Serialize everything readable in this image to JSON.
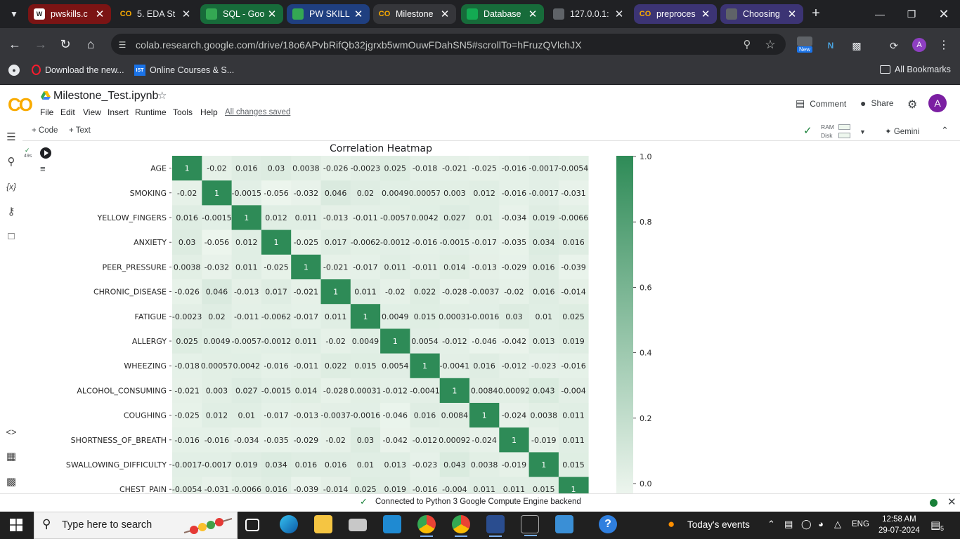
{
  "browser": {
    "tabs": [
      {
        "title": "pwskills.c",
        "style": "red",
        "icon": "github-icon"
      },
      {
        "title": "5. EDA St",
        "style": "dark",
        "icon": "colab-icon"
      },
      {
        "title": "SQL - Goo",
        "style": "green",
        "icon": "drive-icon"
      },
      {
        "title": "PW SKILL",
        "style": "blue",
        "icon": "drive-icon"
      },
      {
        "title": "Milestone",
        "style": "active",
        "icon": "colab-icon"
      },
      {
        "title": "Database",
        "style": "green",
        "icon": "mongodb-icon"
      },
      {
        "title": "127.0.0.1:",
        "style": "dark",
        "icon": "globe-icon"
      },
      {
        "title": "preproces",
        "style": "purple",
        "icon": "colab-icon"
      },
      {
        "title": "Choosing",
        "style": "purple",
        "icon": "globe-icon"
      }
    ],
    "url": "colab.research.google.com/drive/18o6APvbRifQb32jgrxb5wmOuwFDahSN5#scrollTo=hFruzQVlchJX",
    "new_badge": "New",
    "profile_initial": "A",
    "bookmarks": [
      {
        "label": "Download the new...",
        "icon": "opera-icon"
      },
      {
        "label": "Online Courses & S...",
        "icon": "ist-icon"
      }
    ],
    "all_bookmarks": "All Bookmarks"
  },
  "colab": {
    "logo": "CO",
    "notebook_title": "Milestone_Test.ipynb",
    "menu": [
      "File",
      "Edit",
      "View",
      "Insert",
      "Runtime",
      "Tools",
      "Help"
    ],
    "saved_status": "All changes saved",
    "comment_label": "Comment",
    "share_label": "Share",
    "avatar_initial": "A",
    "add_code": "+ Code",
    "add_text": "+ Text",
    "ram_label": "RAM",
    "disk_label": "Disk",
    "gemini_label": "Gemini",
    "cell_exec_time": "49s",
    "status_text": "Connected to Python 3 Google Compute Engine backend"
  },
  "chart_data": {
    "type": "heatmap",
    "title": "Correlation Heatmap",
    "rows": [
      "AGE",
      "SMOKING",
      "YELLOW_FINGERS",
      "ANXIETY",
      "PEER_PRESSURE",
      "CHRONIC_DISEASE",
      "FATIGUE",
      "ALLERGY",
      "WHEEZING",
      "ALCOHOL_CONSUMING",
      "COUGHING",
      "SHORTNESS_OF_BREATH",
      "SWALLOWING_DIFFICULTY",
      "CHEST_PAIN"
    ],
    "values": [
      [
        "1",
        "-0.02",
        "0.016",
        "0.03",
        "0.0038",
        "-0.026",
        "-0.0023",
        "0.025",
        "-0.018",
        "-0.021",
        "-0.025",
        "-0.016",
        "-0.0017",
        "-0.0054"
      ],
      [
        "-0.02",
        "1",
        "-0.0015",
        "-0.056",
        "-0.032",
        "0.046",
        "0.02",
        "0.0049",
        "0.00057",
        "0.003",
        "0.012",
        "-0.016",
        "-0.0017",
        "-0.031"
      ],
      [
        "0.016",
        "-0.0015",
        "1",
        "0.012",
        "0.011",
        "-0.013",
        "-0.011",
        "-0.0057",
        "0.0042",
        "0.027",
        "0.01",
        "-0.034",
        "0.019",
        "-0.0066"
      ],
      [
        "0.03",
        "-0.056",
        "0.012",
        "1",
        "-0.025",
        "0.017",
        "-0.0062",
        "-0.0012",
        "-0.016",
        "-0.0015",
        "-0.017",
        "-0.035",
        "0.034",
        "0.016"
      ],
      [
        "0.0038",
        "-0.032",
        "0.011",
        "-0.025",
        "1",
        "-0.021",
        "-0.017",
        "0.011",
        "-0.011",
        "0.014",
        "-0.013",
        "-0.029",
        "0.016",
        "-0.039"
      ],
      [
        "-0.026",
        "0.046",
        "-0.013",
        "0.017",
        "-0.021",
        "1",
        "0.011",
        "-0.02",
        "0.022",
        "-0.028",
        "-0.0037",
        "-0.02",
        "0.016",
        "-0.014"
      ],
      [
        "-0.0023",
        "0.02",
        "-0.011",
        "-0.0062",
        "-0.017",
        "0.011",
        "1",
        "0.0049",
        "0.015",
        "0.00031",
        "-0.0016",
        "0.03",
        "0.01",
        "0.025"
      ],
      [
        "0.025",
        "0.0049",
        "-0.0057",
        "-0.0012",
        "0.011",
        "-0.02",
        "0.0049",
        "1",
        "0.0054",
        "-0.012",
        "-0.046",
        "-0.042",
        "0.013",
        "0.019"
      ],
      [
        "-0.018",
        "0.00057",
        "0.0042",
        "-0.016",
        "-0.011",
        "0.022",
        "0.015",
        "0.0054",
        "1",
        "-0.0041",
        "0.016",
        "-0.012",
        "-0.023",
        "-0.016"
      ],
      [
        "-0.021",
        "0.003",
        "0.027",
        "-0.0015",
        "0.014",
        "-0.028",
        "0.00031",
        "-0.012",
        "-0.0041",
        "1",
        "0.0084",
        "0.00092",
        "0.043",
        "-0.004"
      ],
      [
        "-0.025",
        "0.012",
        "0.01",
        "-0.017",
        "-0.013",
        "-0.0037",
        "-0.0016",
        "-0.046",
        "0.016",
        "0.0084",
        "1",
        "-0.024",
        "0.0038",
        "0.011"
      ],
      [
        "-0.016",
        "-0.016",
        "-0.034",
        "-0.035",
        "-0.029",
        "-0.02",
        "0.03",
        "-0.042",
        "-0.012",
        "0.00092",
        "-0.024",
        "1",
        "-0.019",
        "0.011"
      ],
      [
        "-0.0017",
        "-0.0017",
        "0.019",
        "0.034",
        "0.016",
        "0.016",
        "0.01",
        "0.013",
        "-0.023",
        "0.043",
        "0.0038",
        "-0.019",
        "1",
        "0.015"
      ],
      [
        "-0.0054",
        "-0.031",
        "-0.0066",
        "0.016",
        "-0.039",
        "-0.014",
        "0.025",
        "0.019",
        "-0.016",
        "-0.004",
        "0.011",
        "0.011",
        "0.015",
        "1"
      ]
    ],
    "colorbar_ticks": [
      "1.0",
      "0.8",
      "0.6",
      "0.4",
      "0.2",
      "0.0"
    ],
    "colorbar_range": [
      -0.06,
      1.0
    ],
    "color_low": "#edf5ee",
    "color_high": "#2e8b57"
  },
  "taskbar": {
    "search_placeholder": "Type here to search",
    "events_label": "Today's events",
    "language": "ENG",
    "time": "12:58 AM",
    "date": "29-07-2024",
    "notification_count": "5"
  }
}
